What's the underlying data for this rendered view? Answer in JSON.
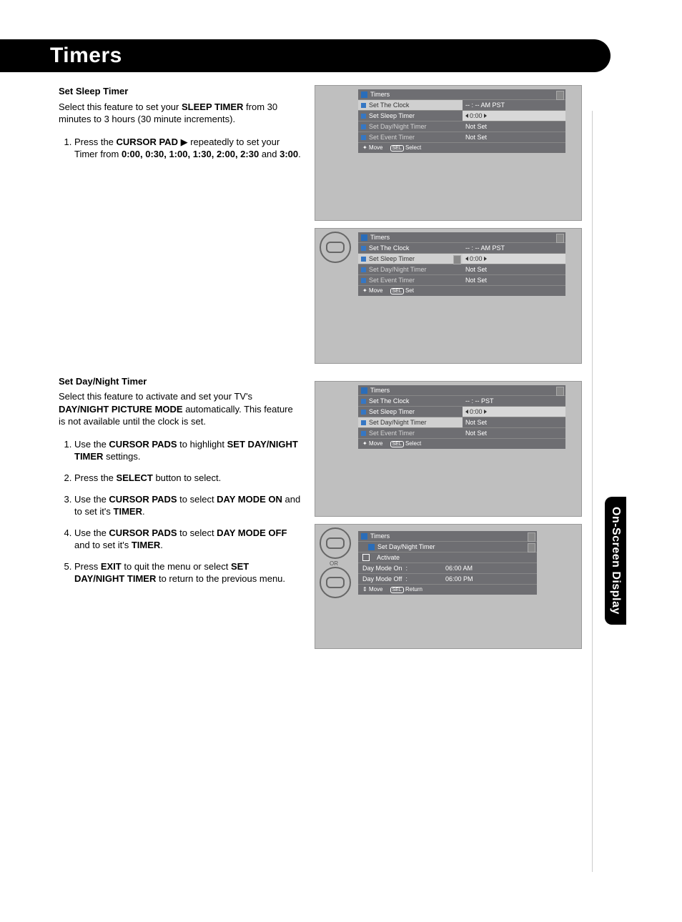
{
  "header": {
    "title": "Timers"
  },
  "sideTab": "On-Screen Display",
  "sleep": {
    "title": "Set Sleep Timer",
    "intro_a": "Select this feature to set your ",
    "intro_bold": "SLEEP TIMER",
    "intro_b": " from 30 minutes to 3 hours (30 minute increments).",
    "step1_a": "Press the ",
    "step1_bold": "CURSOR PAD",
    "step1_b": " ▶ repeatedly to set your Timer from ",
    "step1_vals": "0:00, 0:30, 1:00, 1:30, 2:00, 2:30",
    "step1_c": " and ",
    "step1_end": "3:00",
    "step1_d": "."
  },
  "dnt": {
    "title": "Set Day/Night Timer",
    "intro_a": "Select this feature to activate and set your TV's ",
    "intro_bold": "DAY/NIGHT PICTURE MODE",
    "intro_b": " automatically. This feature is not available until the clock is set.",
    "s1_a": "Use the ",
    "s1_b": "CURSOR PADS",
    "s1_c": " to highlight ",
    "s1_d": "SET DAY/NIGHT TIMER",
    "s1_e": " settings.",
    "s2_a": "Press the ",
    "s2_b": "SELECT",
    "s2_c": " button to select.",
    "s3_a": "Use the ",
    "s3_b": "CURSOR PADS",
    "s3_c": " to select ",
    "s3_d": "DAY MODE ON",
    "s3_e": " and to set it's ",
    "s3_f": "TIMER",
    "s3_g": ".",
    "s4_a": "Use the ",
    "s4_b": "CURSOR PADS",
    "s4_c": " to select ",
    "s4_d": "DAY MODE OFF",
    "s4_e": " and to set it's ",
    "s4_f": "TIMER",
    "s4_g": ".",
    "s5_a": "Press ",
    "s5_b": "EXIT",
    "s5_c": " to quit the menu or select ",
    "s5_d": "SET DAY/NIGHT TIMER",
    "s5_e": " to return to the previous menu."
  },
  "osd_common": {
    "menuTitle": "Timers",
    "items": {
      "clock": "Set The Clock",
      "sleep": "Set Sleep Timer",
      "dnt": "Set Day/Night Timer",
      "event": "Set Event Timer"
    },
    "notset": "Not Set",
    "move": "Move",
    "select": "Select",
    "set": "Set",
    "ret": "Return",
    "sel": "SEL"
  },
  "osd1": {
    "clockVal": "-- : --  AM PST",
    "sleepVal": "0:00"
  },
  "osd2": {
    "clockVal": "-- : --  AM PST",
    "sleepVal": "0:00"
  },
  "osd3": {
    "clockVal": "-- : --  PST",
    "sleepVal": "0:00"
  },
  "osd4": {
    "title": "Set Day/Night Timer",
    "activate": "Activate",
    "dayOnLabel": "Day Mode On",
    "dayOnVal": "06:00 AM",
    "dayOffLabel": "Day Mode Off",
    "dayOffVal": "06:00 PM"
  },
  "remoteOr": "OR"
}
